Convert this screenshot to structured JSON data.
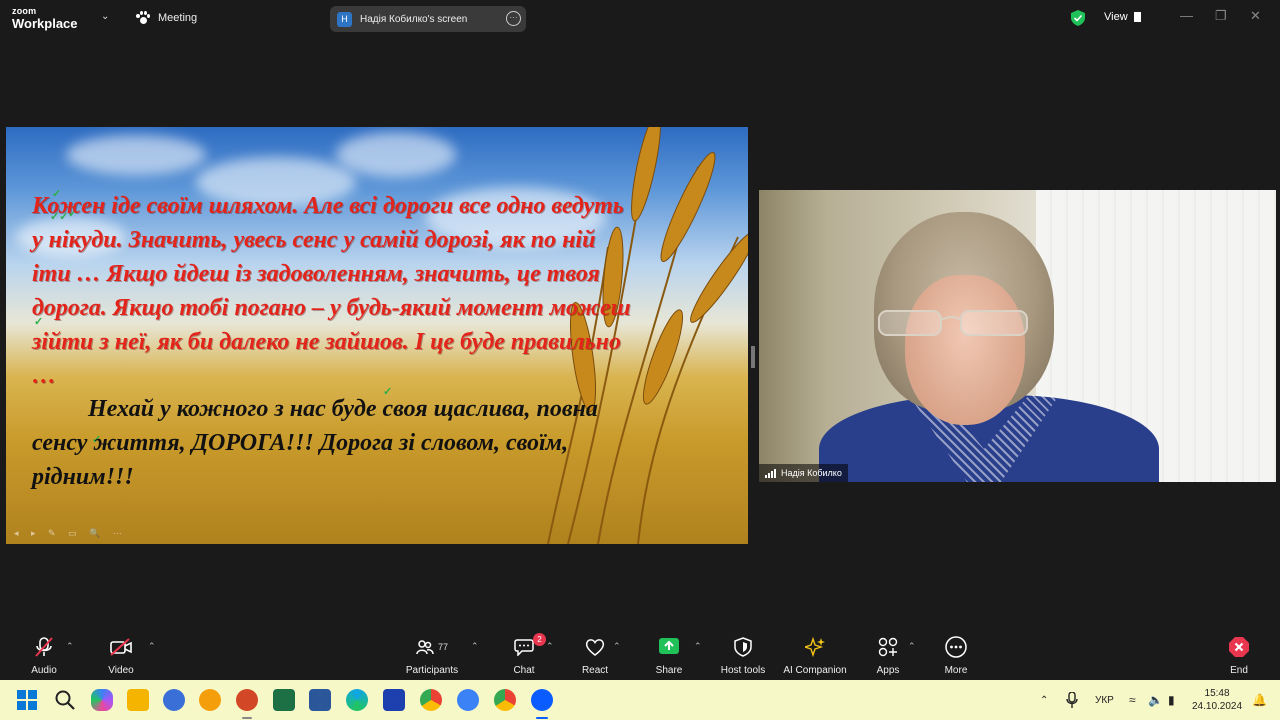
{
  "app": {
    "logo_small": "zoom",
    "logo_big": "Workplace",
    "meeting_label": "Meeting",
    "shared_screen_label": "Надія Кобилко's screen",
    "shared_screen_initial": "H",
    "view_label": "View"
  },
  "slide": {
    "red_text": "Кожен іде своїм шляхом. Але всі дороги все одно ведуть у нікуди. Значить, увесь сенс у самій дорозі, як по ній іти … Якщо йдеш із задоволенням, значить, це твоя дорога. Якщо тобі погано – у будь-який момент можеш зійти з неї, як би далеко не зайшов. І це буде правильно …",
    "black_text": "Нехай у кожного з нас буде своя щаслива, повна сенсу життя, ДОРОГА!!! Дорога зі словом, своїм, рідним!!!"
  },
  "participant": {
    "name": "Надія Кобилко"
  },
  "toolbar": {
    "audio": "Audio",
    "video": "Video",
    "participants": "Participants",
    "participants_count": "77",
    "chat": "Chat",
    "chat_badge": "2",
    "react": "React",
    "share": "Share",
    "host_tools": "Host tools",
    "ai_companion": "AI Companion",
    "apps": "Apps",
    "more": "More",
    "end": "End"
  },
  "taskbar": {
    "language": "УКР",
    "time": "15:48",
    "date": "24.10.2024"
  },
  "colors": {
    "accent_blue": "#0b5cff",
    "share_green": "#21c15a",
    "end_red": "#e8364f",
    "slide_red": "#e3241b"
  }
}
